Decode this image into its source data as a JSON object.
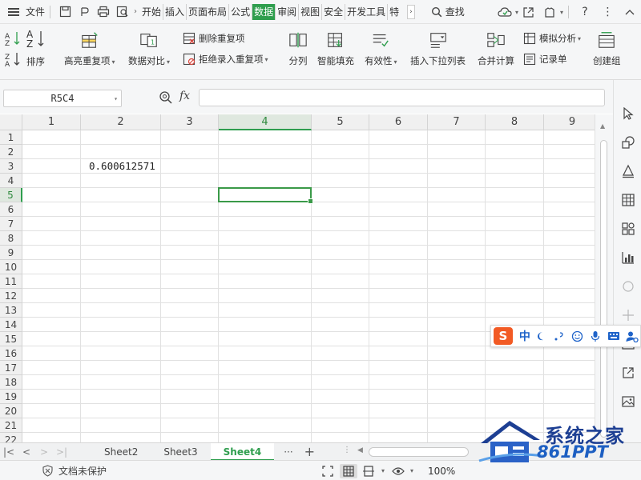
{
  "menubar": {
    "file_label": "文件",
    "tabs": [
      {
        "label": "开始",
        "active": false
      },
      {
        "label": "插入",
        "active": false
      },
      {
        "label": "页面布局",
        "active": false
      },
      {
        "label": "公式",
        "active": false
      },
      {
        "label": "数据",
        "active": true
      },
      {
        "label": "审阅",
        "active": false
      },
      {
        "label": "视图",
        "active": false
      },
      {
        "label": "安全",
        "active": false
      },
      {
        "label": "开发工具",
        "active": false
      },
      {
        "label": "特色",
        "active": false
      }
    ],
    "search_label": "查找",
    "quick_icons": [
      "save-icon",
      "undo-icon",
      "print-icon",
      "preview-icon"
    ],
    "right_icons": [
      "cloud-sync-icon",
      "share-icon",
      "skin-icon",
      "help-icon",
      "more-icon",
      "collapse-icon"
    ]
  },
  "ribbon": {
    "sort": {
      "label": "排序"
    },
    "highlight_dup": {
      "label": "高亮重复项"
    },
    "compare": {
      "label": "数据对比"
    },
    "delete_dup": {
      "label": "删除重复项"
    },
    "reject_dup": {
      "label": "拒绝录入重复项"
    },
    "split": {
      "label": "分列"
    },
    "smart_fill": {
      "label": "智能填充"
    },
    "validity": {
      "label": "有效性"
    },
    "dropdown": {
      "label": "插入下拉列表"
    },
    "merge_calc": {
      "label": "合并计算"
    },
    "simulate": {
      "label": "模拟分析"
    },
    "record": {
      "label": "记录单"
    },
    "create_group": {
      "label": "创建组"
    }
  },
  "formula": {
    "namebox": "R5C4",
    "fx_label": "fx",
    "content": ""
  },
  "grid": {
    "columns": [
      "1",
      "2",
      "3",
      "4",
      "5",
      "6",
      "7",
      "8",
      "9"
    ],
    "active_column": "4",
    "rows": [
      "1",
      "2",
      "3",
      "4",
      "5",
      "6",
      "7",
      "8",
      "9",
      "10",
      "11",
      "12",
      "13",
      "14",
      "15",
      "16",
      "17",
      "18",
      "19",
      "20",
      "21",
      "22"
    ],
    "active_row": "5",
    "cells": [
      {
        "row": "3",
        "col": "2",
        "value": "0.600612571"
      }
    ]
  },
  "sheets": {
    "tabs": [
      {
        "label": "Sheet2",
        "active": false
      },
      {
        "label": "Sheet3",
        "active": false
      },
      {
        "label": "Sheet4",
        "active": true
      }
    ],
    "add_label": "+",
    "more_label": "···"
  },
  "status": {
    "protect_label": "文档未保护",
    "zoom": "100%"
  },
  "ime": {
    "logo": "S",
    "lang": "中"
  },
  "watermark": {
    "line1": "系统之家",
    "line2": "861PPT"
  },
  "colors": {
    "accent": "#2f9e4e",
    "ime_logo": "#f25a24",
    "watermark_blue": "#1d3f93"
  }
}
